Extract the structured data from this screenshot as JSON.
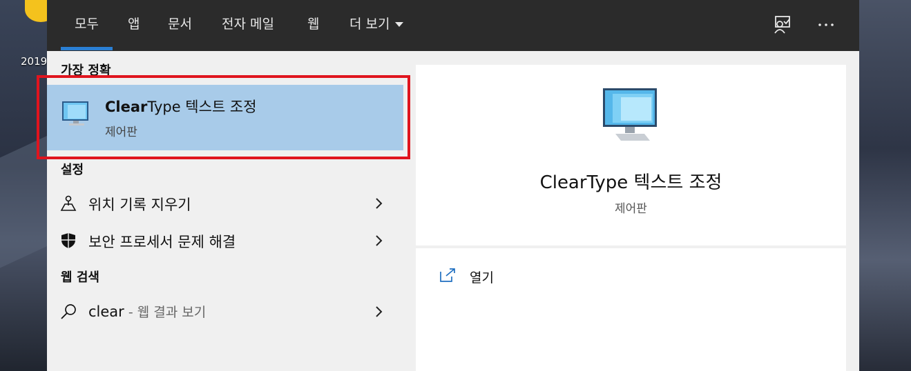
{
  "desktop": {
    "icon_label": "2019"
  },
  "tabs": [
    {
      "label": "모두",
      "selected": true
    },
    {
      "label": "앱"
    },
    {
      "label": "문서"
    },
    {
      "label": "전자 메일"
    },
    {
      "label": "웹"
    },
    {
      "label": "더 보기"
    }
  ],
  "toolbar": {
    "feedback_icon": "feedback-icon",
    "more_icon": "ellipsis-icon",
    "more_label": "···"
  },
  "best_match": {
    "heading": "가장 정확",
    "title_bold": "Clear",
    "title_rest": "Type 텍스트 조정",
    "subtitle": "제어판",
    "icon": "monitor-icon"
  },
  "settings": {
    "heading": "설정",
    "items": [
      {
        "label": "위치 기록 지우기",
        "icon": "location-icon"
      },
      {
        "label": "보안 프로세서 문제 해결",
        "icon": "shield-icon"
      }
    ]
  },
  "web_search": {
    "heading": "웹 검색",
    "query": "clear",
    "suffix": " - 웹 결과 보기",
    "icon": "search-icon"
  },
  "preview": {
    "title": "ClearType 텍스트 조정",
    "subtitle": "제어판",
    "actions": [
      {
        "label": "열기",
        "icon": "open-icon"
      }
    ]
  },
  "colors": {
    "topbar": "#2b2b2b",
    "selected_item": "#a8cbe9",
    "tab_underline": "#2a7fd4",
    "highlight_border": "#e0141e"
  }
}
